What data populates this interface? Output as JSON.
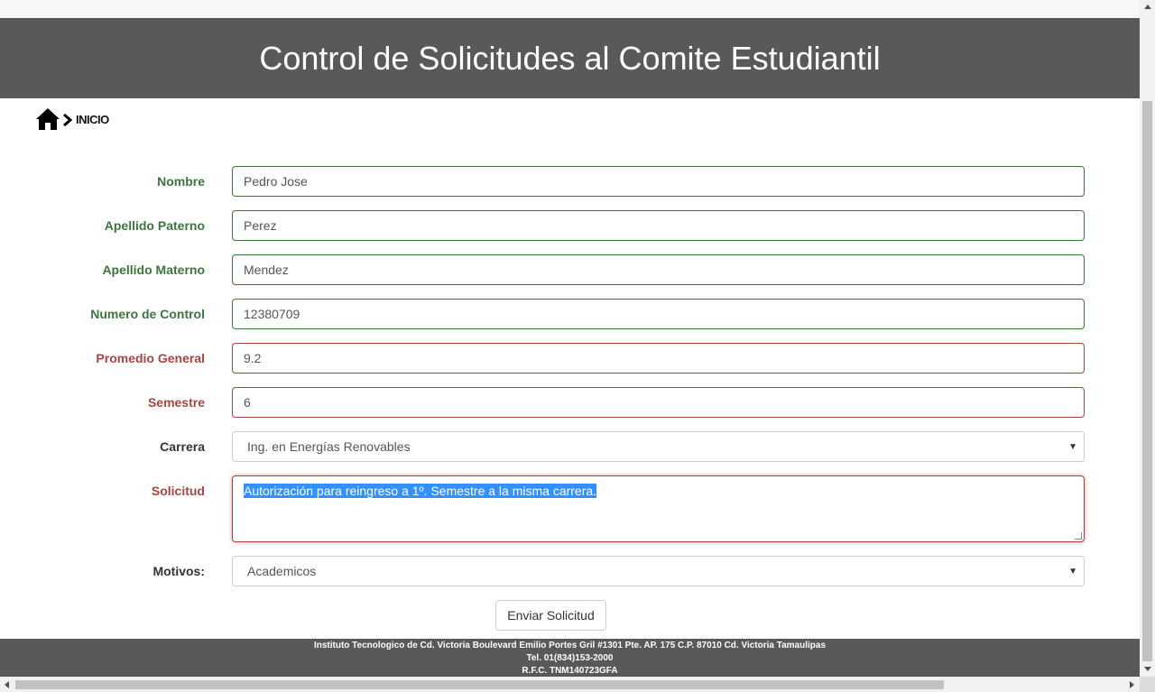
{
  "header": {
    "title": "Control de Solicitudes al Comite Estudiantil"
  },
  "breadcrumb": {
    "home_icon": "home-icon",
    "separator_icon": "chevron-right-icon",
    "label": "INICIO"
  },
  "form": {
    "nombre": {
      "label": "Nombre",
      "value": "Pedro Jose",
      "state": "valid"
    },
    "apellido_paterno": {
      "label": "Apellido Paterno",
      "value": "Perez",
      "state": "valid"
    },
    "apellido_materno": {
      "label": "Apellido Materno",
      "value": "Mendez",
      "state": "valid"
    },
    "numero_control": {
      "label": "Numero de Control",
      "value": "12380709",
      "state": "valid"
    },
    "promedio": {
      "label": "Promedio General",
      "value": "9.2",
      "state": "invalid"
    },
    "semestre": {
      "label": "Semestre",
      "value": "6",
      "state": "invalid"
    },
    "carrera": {
      "label": "Carrera",
      "value": "Ing. en Energías Renovables"
    },
    "solicitud": {
      "label": "Solicitud",
      "value": "Autorización para reingreso  a 1º. Semestre a la misma carrera.",
      "state": "invalid"
    },
    "motivos": {
      "label": "Motivos:",
      "value": "Academicos"
    },
    "submit_label": "Enviar Solicitud"
  },
  "footer": {
    "line1": "Instituto Tecnologico de Cd. Victoria Boulevard Emilio Portes Gril #1301 Pte. AP. 175 C.P. 87010 Cd. Victoria Tamaulipas",
    "line2": "Tel. 01(834)153-2000",
    "line3": "R.F.C. TNM140723GFA"
  },
  "colors": {
    "header_bg": "#595959",
    "valid": "#3c763d",
    "invalid": "#a94442",
    "selection": "#3390ff"
  }
}
